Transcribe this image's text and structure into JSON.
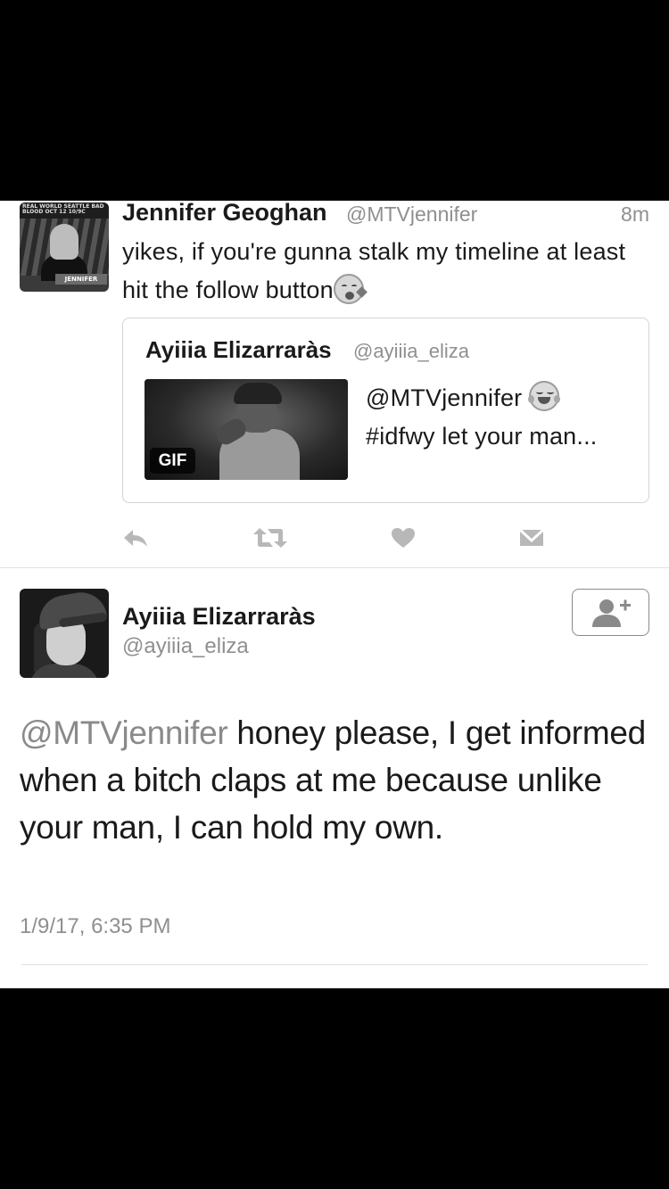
{
  "tweet": {
    "author_name": "Jennifer Geoghan",
    "author_handle": "@MTVjennifer",
    "time": "8m",
    "text": "yikes, if you're gunna stalk my timeline at least hit the follow button",
    "avatar_poster_top": "REAL WORLD SEATTLE BAD BLOOD  OCT 12 10/9C",
    "avatar_poster_label": "JENNIFER",
    "quote": {
      "author_name": "Ayiiia Elizarraràs",
      "author_handle": "@ayiiia_eliza",
      "media_badge": "GIF",
      "text_line1": "@MTVjennifer",
      "text_line2": "#idfwy let your man..."
    },
    "actions": [
      "reply-icon",
      "retweet-icon",
      "like-icon",
      "direct-message-icon"
    ]
  },
  "detail": {
    "author_name": "Ayiiia Elizarraràs",
    "author_handle": "@ayiiia_eliza",
    "mention": "@MTVjennifer",
    "body": " honey please, I get informed when a bitch claps at me because unlike your man, I can hold my own.",
    "timestamp": "1/9/17, 6:35 PM",
    "follow_icon": "add-user-icon"
  },
  "colors": {
    "text": "#1a1a1a",
    "secondary": "#8f8f8f",
    "border": "#d4d4d4",
    "bars": "#000000"
  }
}
